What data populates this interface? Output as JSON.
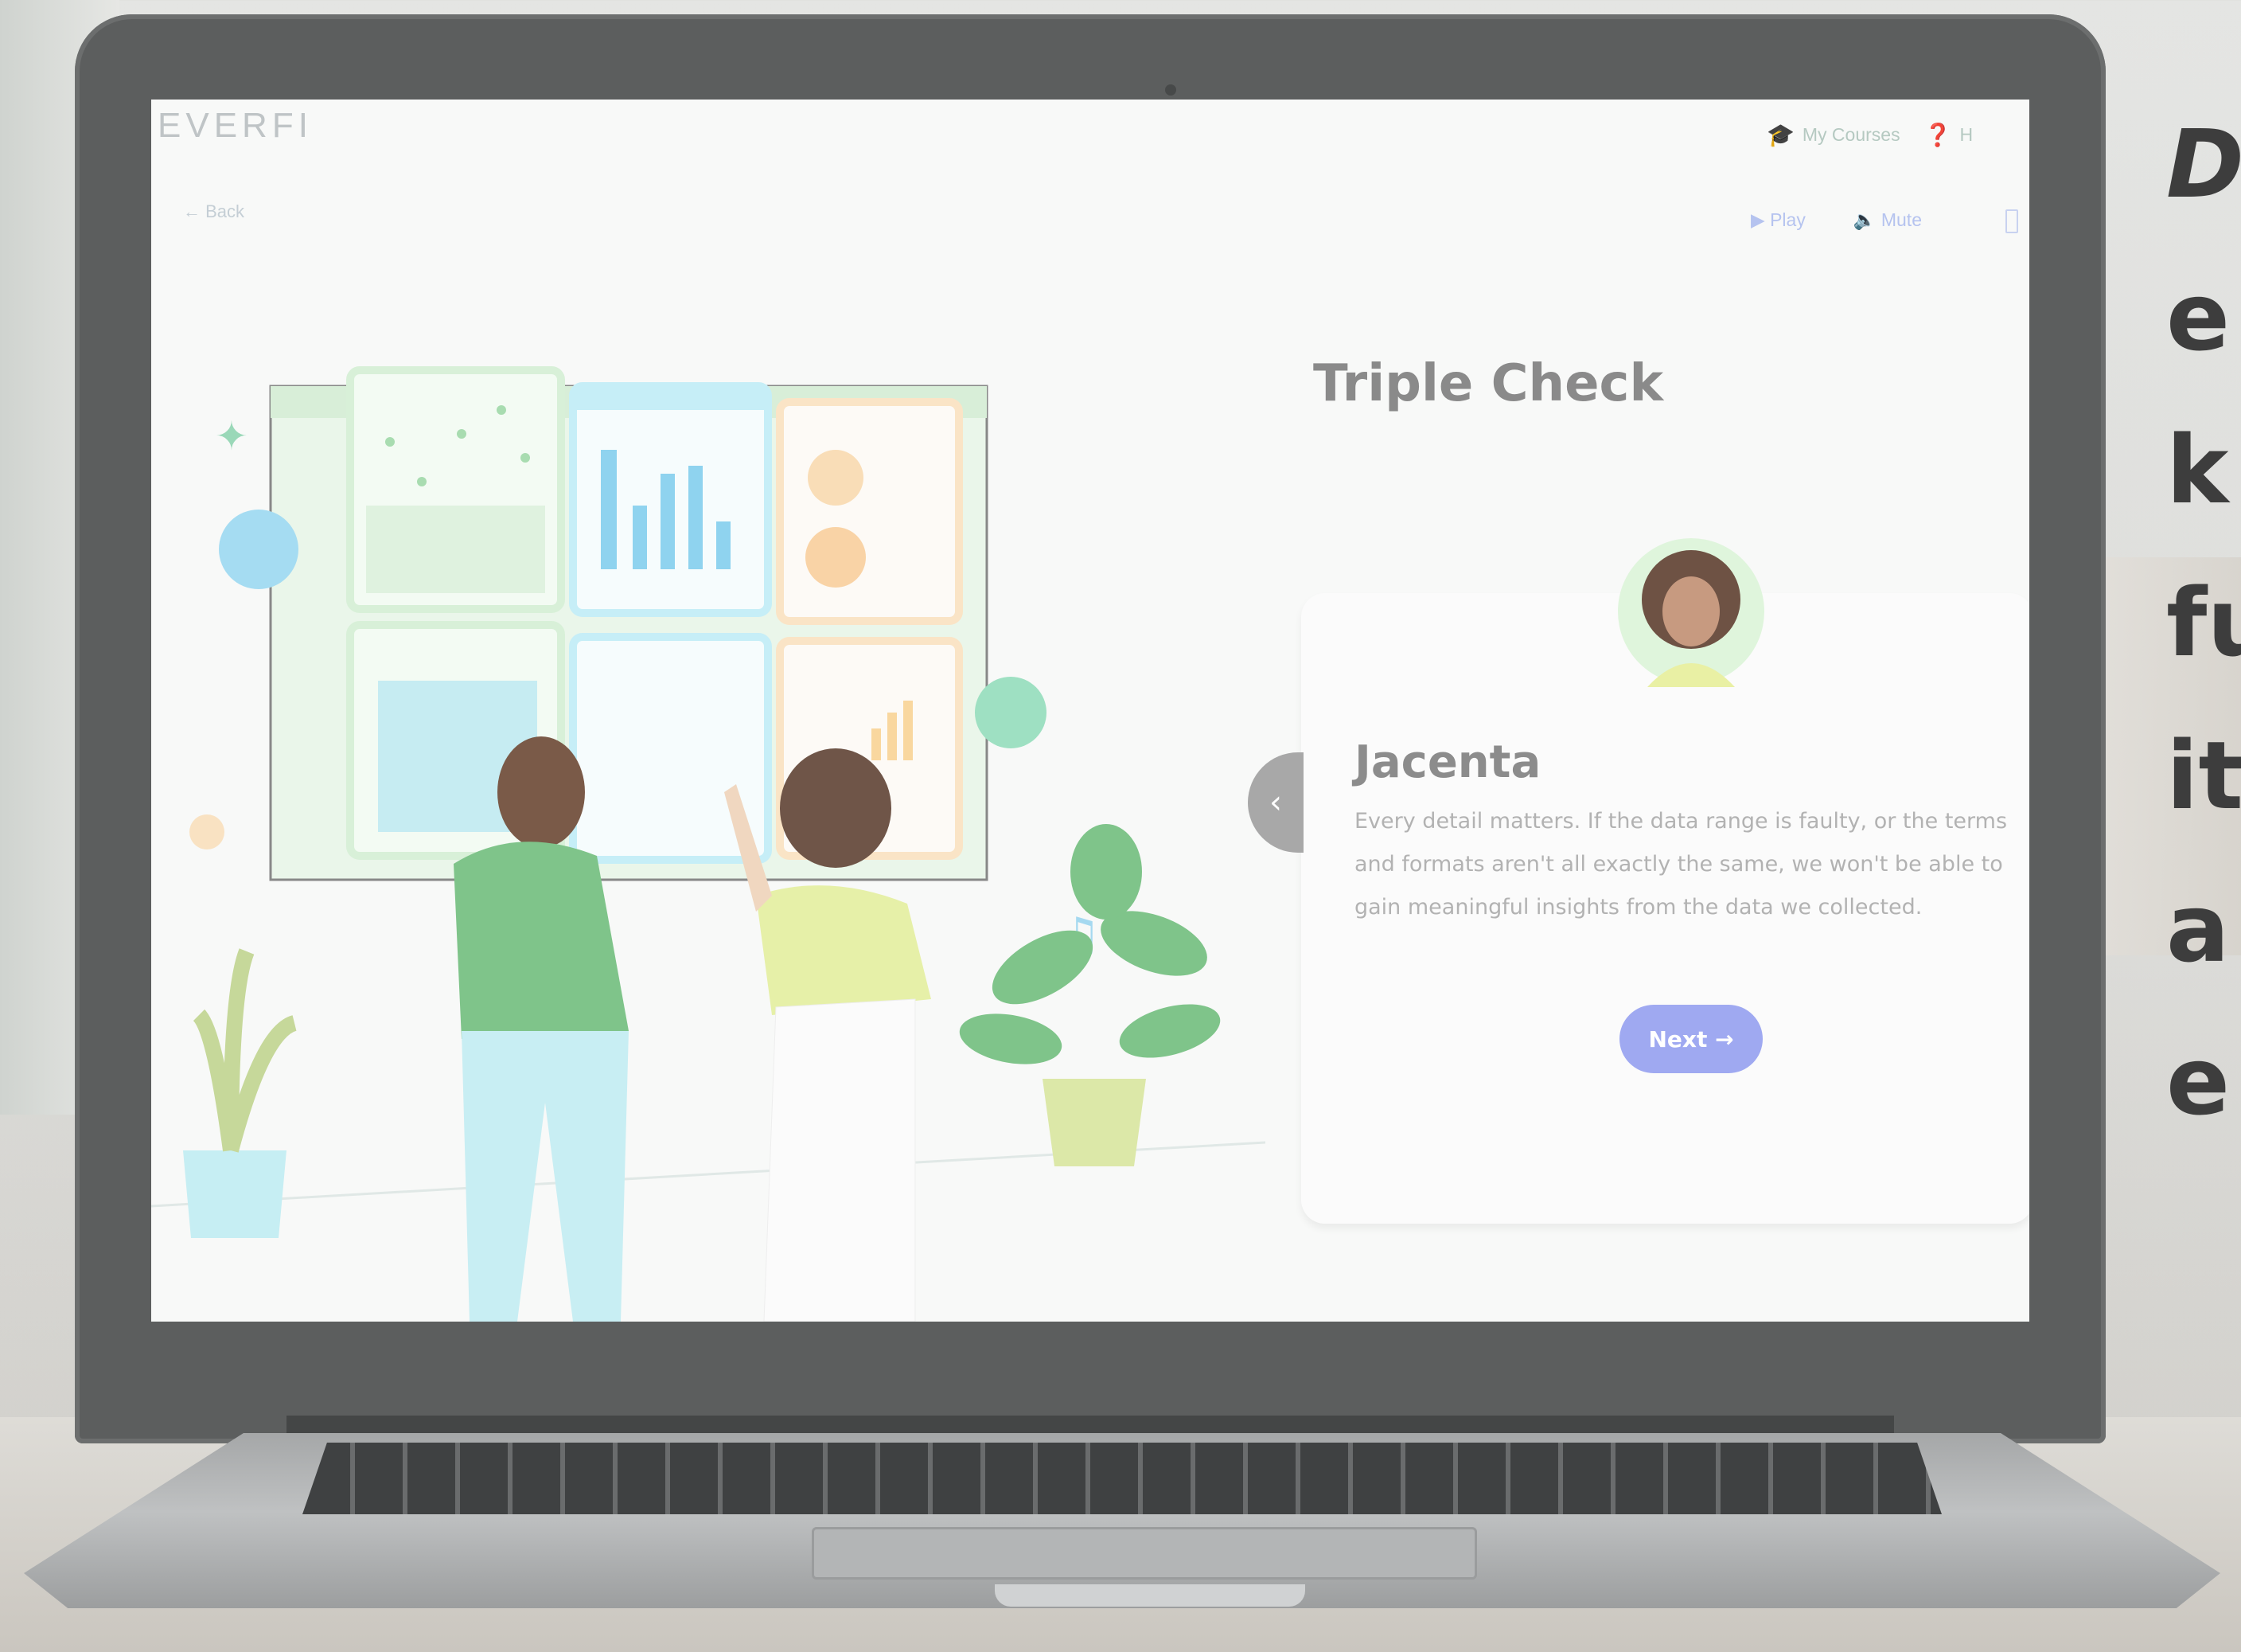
{
  "screen": {
    "logo": "EVERFI",
    "back_label": "← Back",
    "top_nav": [
      {
        "icon": "graduation-cap-icon",
        "glyph": "🎓",
        "label": "My Courses"
      },
      {
        "icon": "help-icon",
        "glyph": "❓",
        "label": "H"
      }
    ],
    "media": {
      "play_label": "▶ Play",
      "mute_label": "🔈 Mute"
    },
    "lesson_title": "Triple Check",
    "speaker_name": "Jacenta",
    "dialogue": "Every detail matters. If the data range is faulty, or the terms and formats aren't all exactly the same, we won't be able to gain meaningful insights from the data we collected.",
    "next_label": "Next →",
    "prev_glyph": "‹"
  },
  "side_text": [
    "D",
    "e",
    "k",
    "fu",
    "it",
    "a",
    "e"
  ],
  "colors": {
    "accent_button": "#9fa9f1",
    "nav_green": "#b5c9c1",
    "title_gray": "#8a8a8a"
  }
}
